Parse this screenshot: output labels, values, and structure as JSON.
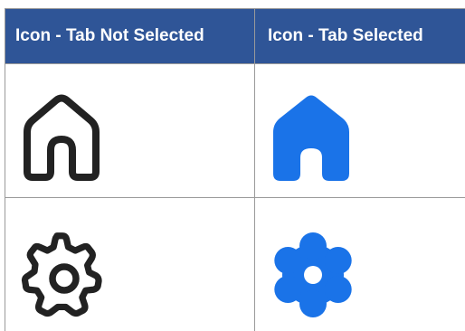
{
  "table": {
    "headers": [
      {
        "label": "Icon - Tab Not Selected"
      },
      {
        "label": "Icon - Tab Selected"
      }
    ],
    "rows": [
      {
        "not_selected_icon": "home-outline-icon",
        "selected_icon": "home-filled-icon"
      },
      {
        "not_selected_icon": "settings-outline-icon",
        "selected_icon": "settings-filled-icon"
      }
    ]
  },
  "colors": {
    "header_background": "#2f5597",
    "header_text": "#ffffff",
    "icon_unselected": "#222222",
    "icon_selected": "#1a73e8",
    "grid_line": "#9a9a9a"
  }
}
